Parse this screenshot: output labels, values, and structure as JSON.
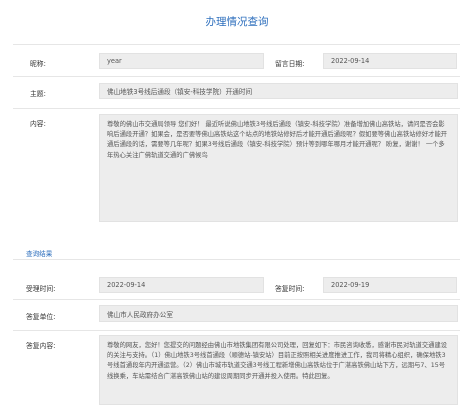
{
  "page_title": "办理情况查询",
  "inquiry": {
    "nickname_label": "昵称:",
    "nickname_value": "year",
    "date_label": "留言日期:",
    "date_value": "2022-09-14",
    "subject_label": "主题:",
    "subject_value": "佛山地铁3号线后通段（镇安-科技学院）开通时间",
    "content_label": "内容:",
    "content_value": "尊敬的佛山市交通局领导 您们好！ 最近听说佛山地铁3号线后通段（镇安-科技学院）准备增加佛山高铁站，请问是否会影响后通段开通？如果会，是否要等佛山高铁站这个站点的地铁站修好后才能开通后通段呢？假如要等佛山高铁站修好才能开通后通段的话，需要等几年呢？如果3号线后通段（镇安-科技学院）预计等到哪年哪月才能开通呢？ 盼复，谢谢！ 一个多年热心关注广佛轨道交通的广佛候鸟"
  },
  "result": {
    "section_title": "查询结果",
    "accept_time_label": "受理时间:",
    "accept_time_value": "2022-09-14",
    "reply_time_label": "答复时间:",
    "reply_time_value": "2022-09-19",
    "reply_unit_label": "答复单位:",
    "reply_unit_value": "佛山市人民政府办公室",
    "reply_content_label": "答复内容:",
    "reply_content_value": "尊敬的网友，您好！您提交的问题经由佛山市地铁集团有限公司处理，回复如下：市民咨询收悉，感谢市民对轨道交通建设的关注与支持。（1）佛山地铁3号线首通段（顺德站-镇安站）目前正按照相关进度推进工作，我司将精心组织，确保地铁3号线首通段年内开通运营。（2）佛山市城市轨道交通3号线工程新增佛山高铁站位于广湛高铁佛山站下方，远期与7、15号线换乘，车站需结合广湛高铁佛山站的建设周期同步开通并投入使用。特此回复。"
  }
}
